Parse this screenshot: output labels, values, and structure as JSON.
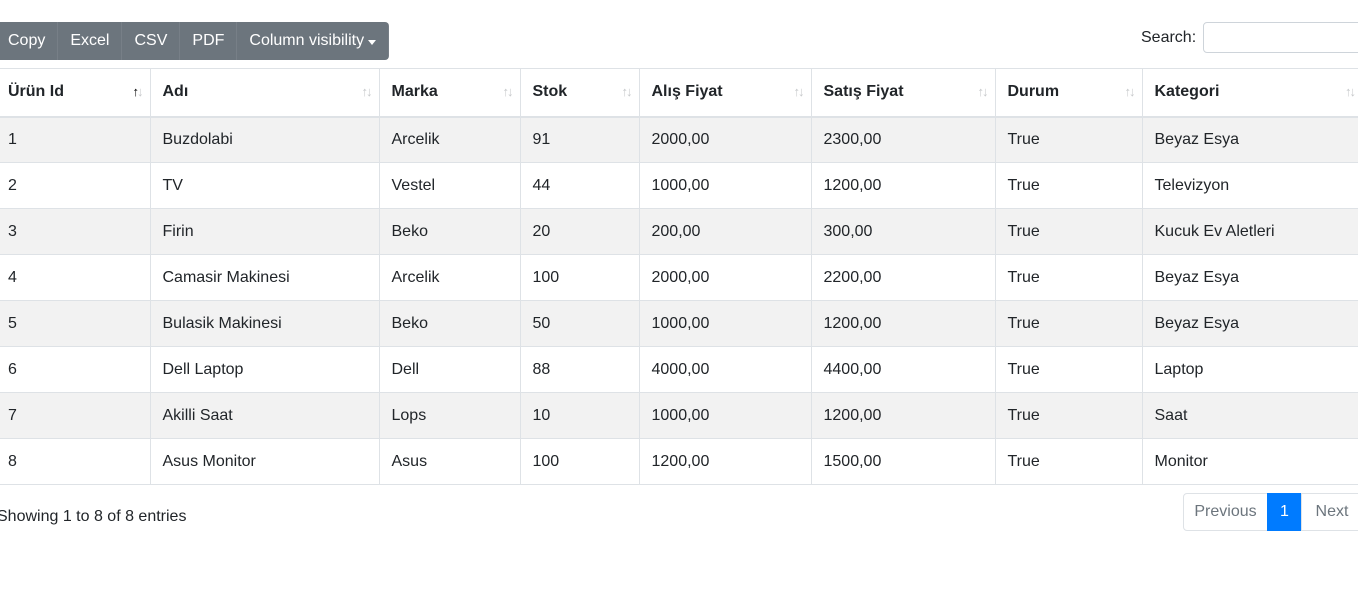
{
  "toolbar": {
    "buttons": [
      "Copy",
      "Excel",
      "CSV",
      "PDF",
      "Column visibility"
    ]
  },
  "search": {
    "label": "Search:",
    "value": ""
  },
  "table": {
    "headers": [
      "Ürün Id",
      "Adı",
      "Marka",
      "Stok",
      "Alış Fiyat",
      "Satış Fiyat",
      "Durum",
      "Kategori"
    ],
    "rows": [
      [
        "1",
        "Buzdolabi",
        "Arcelik",
        "91",
        "2000,00",
        "2300,00",
        "True",
        "Beyaz Esya"
      ],
      [
        "2",
        "TV",
        "Vestel",
        "44",
        "1000,00",
        "1200,00",
        "True",
        "Televizyon"
      ],
      [
        "3",
        "Firin",
        "Beko",
        "20",
        "200,00",
        "300,00",
        "True",
        "Kucuk Ev Aletleri"
      ],
      [
        "4",
        "Camasir Makinesi",
        "Arcelik",
        "100",
        "2000,00",
        "2200,00",
        "True",
        "Beyaz Esya"
      ],
      [
        "5",
        "Bulasik Makinesi",
        "Beko",
        "50",
        "1000,00",
        "1200,00",
        "True",
        "Beyaz Esya"
      ],
      [
        "6",
        "Dell Laptop",
        "Dell",
        "88",
        "4000,00",
        "4400,00",
        "True",
        "Laptop"
      ],
      [
        "7",
        "Akilli Saat",
        "Lops",
        "10",
        "1000,00",
        "1200,00",
        "True",
        "Saat"
      ],
      [
        "8",
        "Asus Monitor",
        "Asus",
        "100",
        "1200,00",
        "1500,00",
        "True",
        "Monitor"
      ]
    ]
  },
  "footer": {
    "info": "Showing 1 to 8 of 8 entries",
    "pagination": {
      "previous": "Previous",
      "current": "1",
      "next": "Next"
    }
  },
  "colors": {
    "toolbar_bg": "#6c757d",
    "accent": "#007bff",
    "stripe": "#f2f2f2"
  }
}
